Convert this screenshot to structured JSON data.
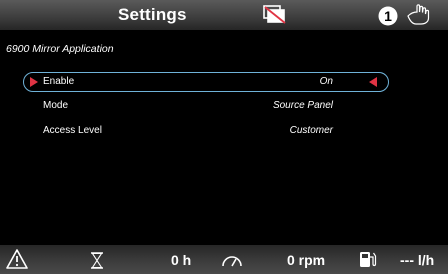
{
  "header": {
    "title": "Settings",
    "icons": [
      "screen-off-icon",
      "alert-number-icon",
      "hand-icon"
    ],
    "alert_badge": "1"
  },
  "section": {
    "title": "6900 Mirror Application"
  },
  "settings": [
    {
      "label": "Enable",
      "value": "On",
      "selected": true
    },
    {
      "label": "Mode",
      "value": "Source Panel",
      "selected": false
    },
    {
      "label": "Access Level",
      "value": "Customer",
      "selected": false
    }
  ],
  "footer": {
    "icons": [
      "warning-icon",
      "hourglass-icon",
      "gauge-icon",
      "fuel-icon"
    ],
    "hours": "0 h",
    "rpm": "0 rpm",
    "fuel_rate": "--- l/h"
  },
  "colors": {
    "selection_border": "#6fb2d8",
    "arrow_accent": "#e03444",
    "header_bg": "#4a4a4a"
  }
}
